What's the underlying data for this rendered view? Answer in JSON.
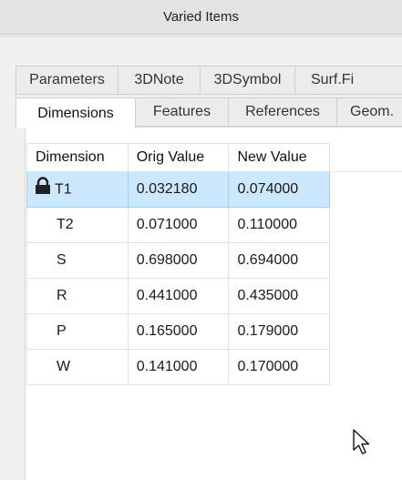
{
  "window": {
    "title": "Varied Items"
  },
  "tabs_back": [
    {
      "label": "Parameters"
    },
    {
      "label": "3DNote"
    },
    {
      "label": "3DSymbol"
    },
    {
      "label": "Surf.Fi"
    }
  ],
  "tabs_front": [
    {
      "label": "Dimensions",
      "active": true
    },
    {
      "label": "Features"
    },
    {
      "label": "References"
    },
    {
      "label": "Geom."
    }
  ],
  "table": {
    "columns": [
      "Dimension",
      "Orig Value",
      "New Value"
    ],
    "rows": [
      {
        "dimension": "T1",
        "orig": "0.032180",
        "new": "0.074000",
        "selected": true,
        "locked": true
      },
      {
        "dimension": "T2",
        "orig": "0.071000",
        "new": "0.110000"
      },
      {
        "dimension": "S",
        "orig": "0.698000",
        "new": "0.694000"
      },
      {
        "dimension": "R",
        "orig": "0.441000",
        "new": "0.435000"
      },
      {
        "dimension": "P",
        "orig": "0.165000",
        "new": "0.179000"
      },
      {
        "dimension": "W",
        "orig": "0.141000",
        "new": "0.170000"
      }
    ]
  },
  "icons": {
    "lock": "lock-icon",
    "cursor": "mouse-pointer-icon"
  },
  "colors": {
    "selection_fill": "#cce8ff",
    "selection_border": "#99d1ff"
  }
}
